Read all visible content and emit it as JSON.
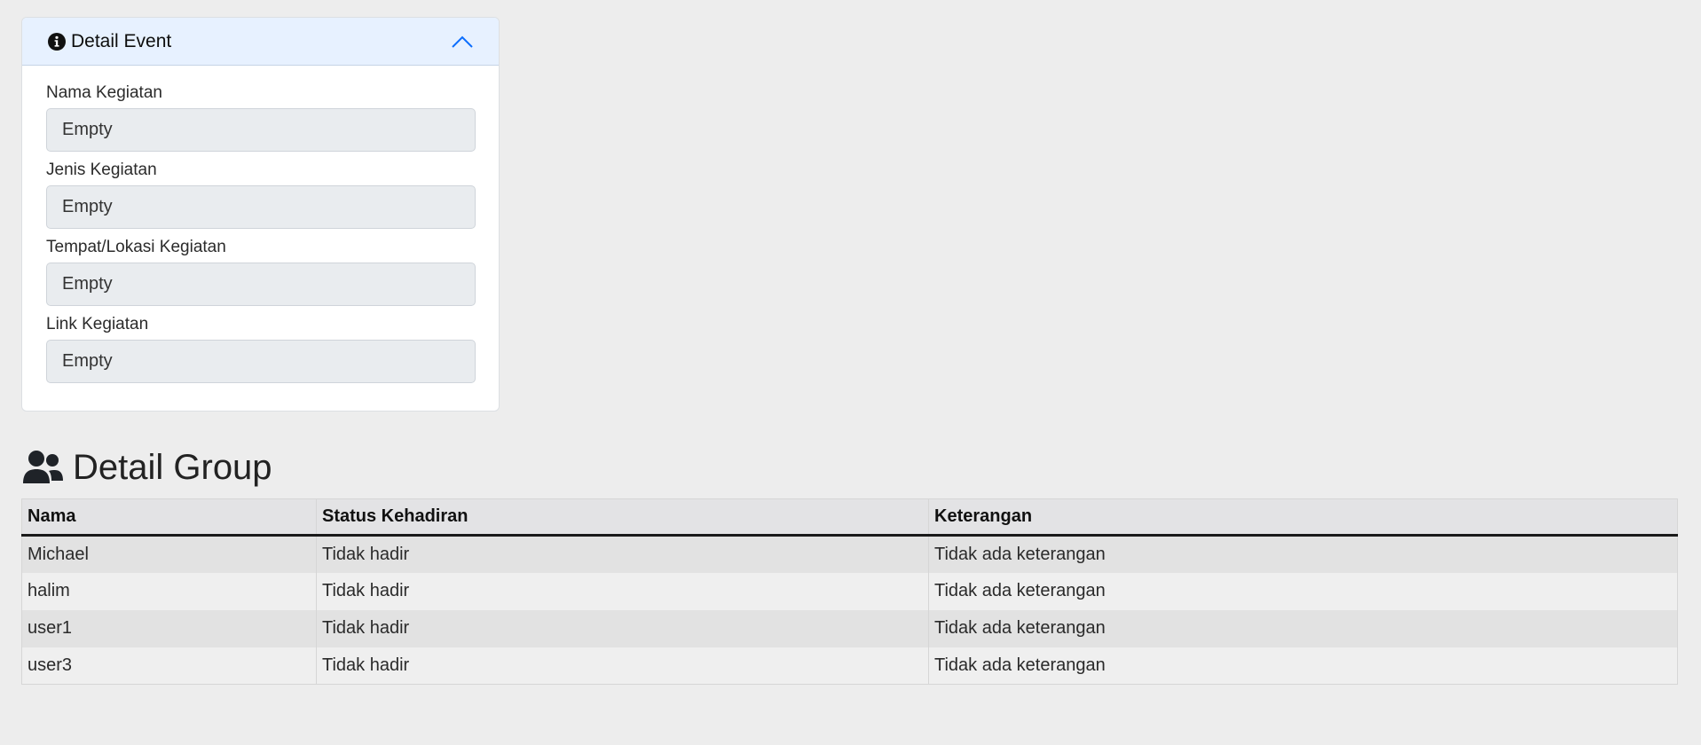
{
  "event": {
    "title": "Detail Event",
    "fields": [
      {
        "label": "Nama Kegiatan",
        "value": "Empty"
      },
      {
        "label": "Jenis Kegiatan",
        "value": "Empty"
      },
      {
        "label": "Tempat/Lokasi Kegiatan",
        "value": "Empty"
      },
      {
        "label": "Link Kegiatan",
        "value": "Empty"
      }
    ]
  },
  "group": {
    "title": "Detail Group",
    "columns": [
      "Nama",
      "Status Kehadiran",
      "Keterangan"
    ],
    "rows": [
      [
        "Michael",
        "Tidak hadir",
        "Tidak ada keterangan"
      ],
      [
        "halim",
        "Tidak hadir",
        "Tidak ada keterangan"
      ],
      [
        "user1",
        "Tidak hadir",
        "Tidak ada keterangan"
      ],
      [
        "user3",
        "Tidak hadir",
        "Tidak ada keterangan"
      ]
    ]
  },
  "icons": {
    "event_header": "info-circle-icon",
    "collapse": "chevron-up-icon",
    "group_heading": "users-icon"
  },
  "colors": {
    "page_background": "#ededed",
    "card_header_background": "#e7f1ff",
    "chevron": "#0d6efd",
    "input_background": "#e9ecef"
  }
}
